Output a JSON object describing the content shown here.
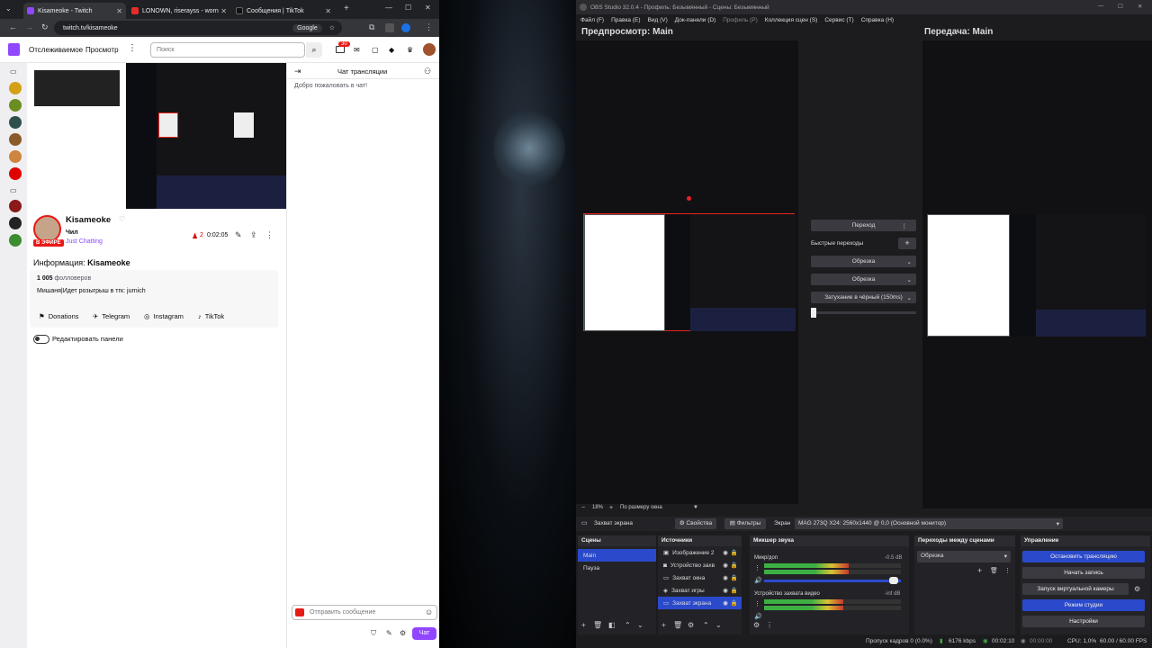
{
  "browser": {
    "tabs": [
      {
        "title": "Kisameoke - Twitch"
      },
      {
        "title": "LONOWN, riserayss - worn"
      },
      {
        "title": "Сообщения | TikTok"
      }
    ],
    "url": "twitch.tv/kisameoke",
    "search_engine": "Google"
  },
  "twitch": {
    "nav": {
      "following": "Отслеживаемое",
      "browse": "Просмотр",
      "search_placeholder": "Поиск",
      "notif_count": "30"
    },
    "channel": {
      "name": "Kisameoke",
      "title": "Чил",
      "category": "Just Chatting",
      "live_badge": "В ЭФИРЕ",
      "viewers": "2",
      "uptime": "0:02:05"
    },
    "about": {
      "heading_prefix": "Информация:",
      "heading_name": "Kisameoke",
      "followers_count": "1 005",
      "followers_label": "фолловеров",
      "description": "Мишаня|Идет розыгрыш в тгк: jurnich",
      "links": [
        "Donations",
        "Telegram",
        "Instagram",
        "TikTok"
      ],
      "edit_panels": "Редактировать панели"
    },
    "chat": {
      "header": "Чат трансляции",
      "welcome": "Добро пожаловать в чат!",
      "input_placeholder": "Отправить сообщение",
      "send": "Чат"
    }
  },
  "obs": {
    "title": "OBS Studio 32.0.4 - Профиль: Безымянный - Сцены: Безымянный",
    "menu": [
      "Файл (F)",
      "Правка (E)",
      "Вид (V)",
      "Док-панели (D)",
      "Профиль (P)",
      "Коллекция сцен (S)",
      "Сервис (T)",
      "Справка (H)"
    ],
    "preview_label": "Предпросмотр: Main",
    "program_label": "Передача: Main",
    "transition": {
      "button": "Переход",
      "quick_label": "Быстрые переходы",
      "options": [
        "Обрезка",
        "Обрезка",
        "Затухание в чёрный (150ms)"
      ]
    },
    "zoom": {
      "percent": "18%",
      "fit": "По размеру окна"
    },
    "source_bar": {
      "selected": "Захват экрана",
      "properties": "Свойства",
      "filters": "Фильтры",
      "screen_label": "Экран",
      "screen_value": "MAG 273Q X24: 2560x1440 @ 0,0 (Основной монитор)"
    },
    "scenes": {
      "header": "Сцены",
      "items": [
        "Main",
        "Пауза"
      ]
    },
    "sources": {
      "header": "Источники",
      "items": [
        "Изображение 2",
        "Устройство захв",
        "Захват окна",
        "Захват игры",
        "Захват экрана"
      ]
    },
    "mixer": {
      "header": "Микшер звука",
      "channels": [
        {
          "name": "Микр/доп",
          "db": "-0.5 dB",
          "level": 0.62
        },
        {
          "name": "Устройство захвата видео",
          "db": "-inf dB",
          "level": 0.58
        }
      ]
    },
    "transitions_dock": {
      "header": "Переходы между сценами",
      "selected": "Обрезка"
    },
    "controls": {
      "header": "Управление",
      "buttons": [
        "Остановить трансляцию",
        "Начать запись",
        "Запуск виртуальной камеры",
        "Режим студии",
        "Настройки"
      ]
    },
    "status": {
      "dropped": "Пропуск кадров 0 (0.0%)",
      "bitrate": "6176 kbps",
      "stream_time": "00:02:10",
      "rec_time": "00:00:00",
      "cpu": "CPU: 1,0%",
      "fps": "60.00 / 60.00 FPS"
    }
  }
}
